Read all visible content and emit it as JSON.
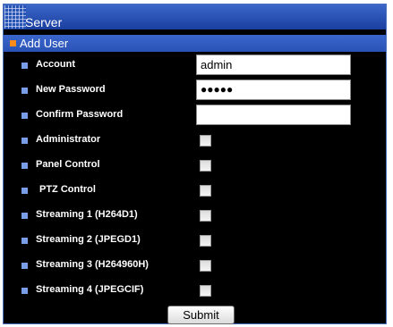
{
  "window": {
    "title": "Server"
  },
  "section": {
    "title": "Add User"
  },
  "fields": [
    {
      "label": "Account",
      "type": "text",
      "value": "admin"
    },
    {
      "label": "New Password",
      "type": "password",
      "value": "●●●●●"
    },
    {
      "label": "Confirm Password",
      "type": "password",
      "value": ""
    }
  ],
  "permissions": [
    {
      "label": "Administrator",
      "checked": false
    },
    {
      "label": "Panel Control",
      "checked": false
    },
    {
      "label": "PTZ Control",
      "checked": false
    },
    {
      "label": "Streaming 1 (H264D1)",
      "checked": false
    },
    {
      "label": "Streaming 2 (JPEGD1)",
      "checked": false
    },
    {
      "label": "Streaming 3 (H264960H)",
      "checked": false
    },
    {
      "label": "Streaming 4 (JPEGCIF)",
      "checked": false
    }
  ],
  "actions": {
    "submit_label": "Submit"
  },
  "colors": {
    "panel_bg": "#000000",
    "header_blue": "#2a52b5",
    "section_bullet": "#ff8c1a",
    "row_bullet": "#7a9de8"
  }
}
